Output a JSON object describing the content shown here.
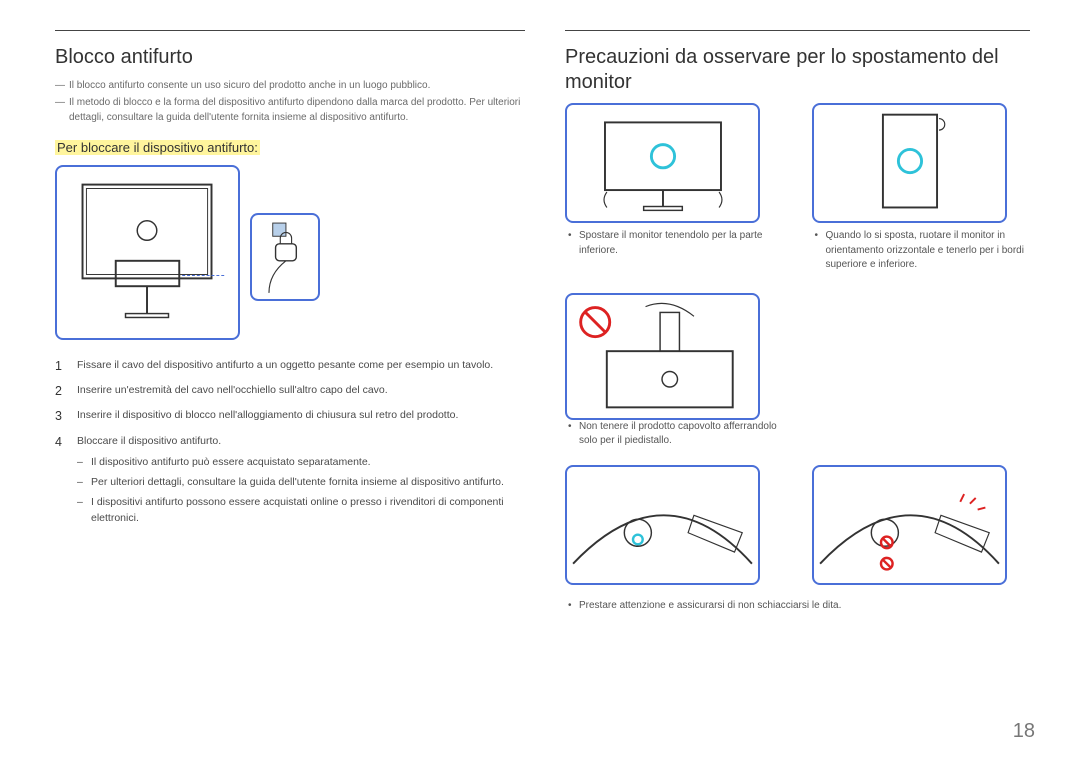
{
  "left": {
    "heading": "Blocco antifurto",
    "notes": [
      "Il blocco antifurto consente un uso sicuro del prodotto anche in un luogo pubblico.",
      "Il metodo di blocco e la forma del dispositivo antifurto dipendono dalla marca del prodotto. Per ulteriori dettagli, consultare la guida dell'utente fornita insieme al dispositivo antifurto."
    ],
    "subheading": "Per bloccare il dispositivo antifurto:",
    "steps": [
      "Fissare il cavo del dispositivo antifurto a un oggetto pesante come per esempio un tavolo.",
      "Inserire un'estremità del cavo nell'occhiello sull'altro capo del cavo.",
      "Inserire il dispositivo di blocco nell'alloggiamento di chiusura sul retro del prodotto.",
      "Bloccare il dispositivo antifurto."
    ],
    "substeps": [
      "Il dispositivo antifurto può essere acquistato separatamente.",
      "Per ulteriori dettagli, consultare la guida dell'utente fornita insieme al dispositivo antifurto.",
      "I dispositivi antifurto possono essere acquistati online o presso i rivenditori di componenti elettronici."
    ]
  },
  "right": {
    "heading": "Precauzioni da osservare per lo spostamento del monitor",
    "captions": {
      "c1": "Spostare il monitor tenendolo per la parte inferiore.",
      "c2": "Quando lo si sposta, ruotare il monitor in orientamento orizzontale e tenerlo per i bordi superiore e inferiore.",
      "c3": "Non tenere il prodotto capovolto afferrandolo solo per il piedistallo.",
      "c4": "Prestare attenzione e assicurarsi di non schiacciarsi le dita."
    }
  },
  "page_number": "18"
}
